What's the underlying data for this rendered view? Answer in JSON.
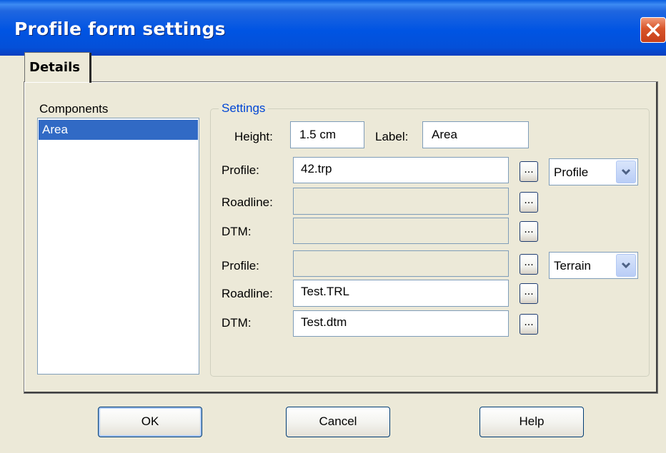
{
  "window": {
    "title": "Profile form settings"
  },
  "tabs": [
    {
      "label": "Details"
    }
  ],
  "components": {
    "label": "Components",
    "items": [
      "Area"
    ]
  },
  "settings": {
    "group_label": "Settings",
    "height_label": "Height:",
    "height_value": "1.5 cm",
    "label_label": "Label:",
    "label_value": "Area",
    "rows": [
      {
        "label": "Profile:",
        "value": "",
        "enabled": true,
        "display": "42.trp"
      },
      {
        "label": "Roadline:",
        "value": "",
        "enabled": false
      },
      {
        "label": "DTM:",
        "value": "",
        "enabled": false
      },
      {
        "label": "Profile:",
        "value": "",
        "enabled": false
      },
      {
        "label": "Roadline:",
        "value": "Test.TRL",
        "enabled": true
      },
      {
        "label": "DTM:",
        "value": "Test.dtm",
        "enabled": true
      }
    ],
    "profile_combo": {
      "selected": "Profile"
    },
    "terrain_combo": {
      "selected": "Terrain"
    },
    "browse_label": "..."
  },
  "buttons": {
    "ok": "OK",
    "cancel": "Cancel",
    "help": "Help"
  },
  "colors": {
    "titlebar": "#0054e3",
    "selection": "#316ac5",
    "group_label": "#0046d5",
    "dialog_bg": "#ece9d8"
  },
  "icons": {
    "close": "close-icon",
    "dropdown": "chevron-down-icon"
  }
}
